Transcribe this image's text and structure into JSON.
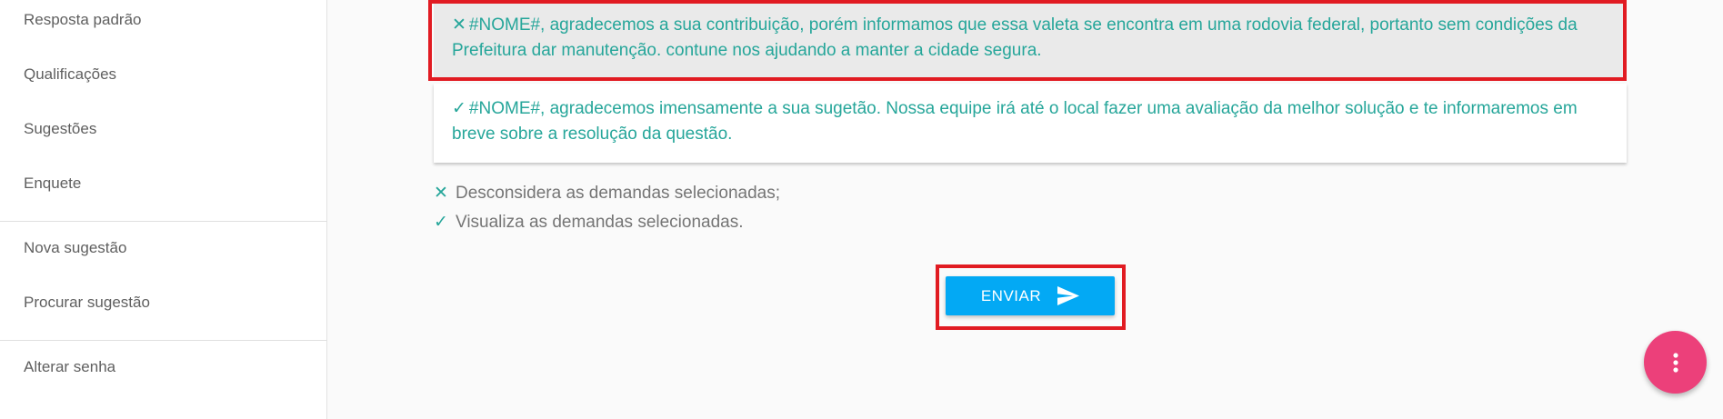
{
  "sidebar": {
    "items": [
      {
        "label": "Resposta padrão"
      },
      {
        "label": "Qualificações"
      },
      {
        "label": "Sugestões"
      },
      {
        "label": "Enquete"
      },
      {
        "label": "Nova sugestão"
      },
      {
        "label": "Procurar sugestão"
      },
      {
        "label": "Alterar senha"
      }
    ]
  },
  "responses": [
    {
      "mark": "✕",
      "text": "#NOME#, agradecemos a sua contribuição, porém informamos que essa valeta se encontra em uma rodovia federal, portanto sem condições da Prefeitura dar manutenção. contune nos ajudando a manter a cidade segura."
    },
    {
      "mark": "✓",
      "text": "#NOME#, agradecemos imensamente a sua sugetão. Nossa equipe irá até o local fazer uma avaliação da melhor solução e te informaremos em breve sobre a resolução da questão."
    }
  ],
  "legend": {
    "discard": {
      "mark": "✕",
      "text": "Desconsidera as demandas selecionadas;"
    },
    "view": {
      "mark": "✓",
      "text": "Visualiza as demandas selecionadas."
    }
  },
  "send_button": {
    "label": "ENVIAR",
    "icon": "send-icon"
  },
  "fab": {
    "icon": "more-vert-icon"
  },
  "colors": {
    "accent": "#26a69a",
    "button": "#03a9f4",
    "fab": "#ec407a",
    "highlight": "#e11b22"
  }
}
